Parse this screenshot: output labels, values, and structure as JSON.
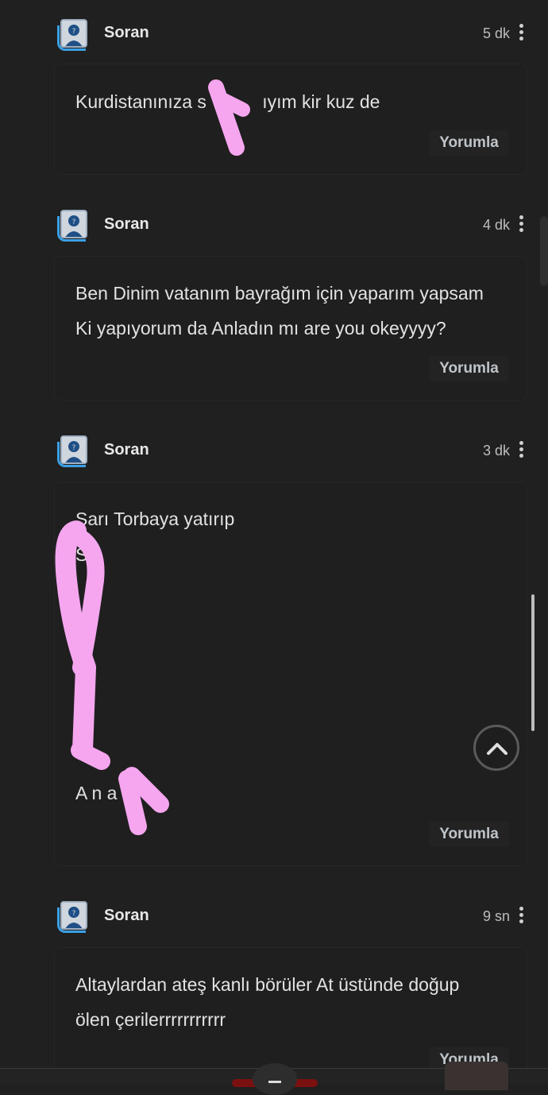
{
  "comments": [
    {
      "username": "Soran",
      "time": "5 dk",
      "lines": [
        "Kurdistanınıza s           ıyım kir kuz de"
      ],
      "reply_label": "Yorumla"
    },
    {
      "username": "Soran",
      "time": "4 dk",
      "lines": [
        "Ben Dinim vatanım bayrağım için yaparım yapsam",
        "Ki yapıyorum da Anladın mı are you okeyyyy?"
      ],
      "reply_label": "Yorumla"
    },
    {
      "username": "Soran",
      "time": "3 dk",
      "lines": [
        "Sarı Torbaya yatırıp",
        "S",
        "A n a"
      ],
      "reply_label": "Yorumla"
    },
    {
      "username": "Soran",
      "time": "9 sn",
      "lines": [
        "Altaylardan ateş kanlı börüler At üstünde doğup",
        "ölen çerilerrrrrrrrrrr"
      ],
      "reply_label": "Yorumla"
    }
  ],
  "icons": {
    "avatar": "default-user-avatar-icon",
    "more": "more-vertical-icon",
    "scroll_top": "chevron-up-icon"
  },
  "colors": {
    "background": "#202020",
    "scribble": "#f5a6ef",
    "avatar_accent": "#3aa0e6"
  }
}
